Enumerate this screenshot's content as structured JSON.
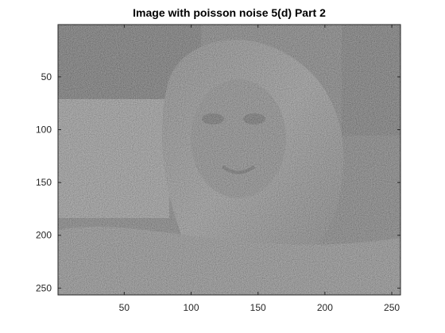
{
  "figure": {
    "title": "Image with poisson noise 5(d) Part 2",
    "image_description_kind": "grayscale noisy photo",
    "colormap": "gray"
  },
  "axes": {
    "x_ticks": [
      "50",
      "100",
      "150",
      "200",
      "250"
    ],
    "y_ticks": [
      "50",
      "100",
      "150",
      "200",
      "250"
    ],
    "x_range": [
      0.5,
      256.5
    ],
    "y_range": [
      0.5,
      256.5
    ],
    "y_direction": "reverse"
  },
  "colors": {
    "axis": "#262626",
    "background": "#ffffff"
  }
}
